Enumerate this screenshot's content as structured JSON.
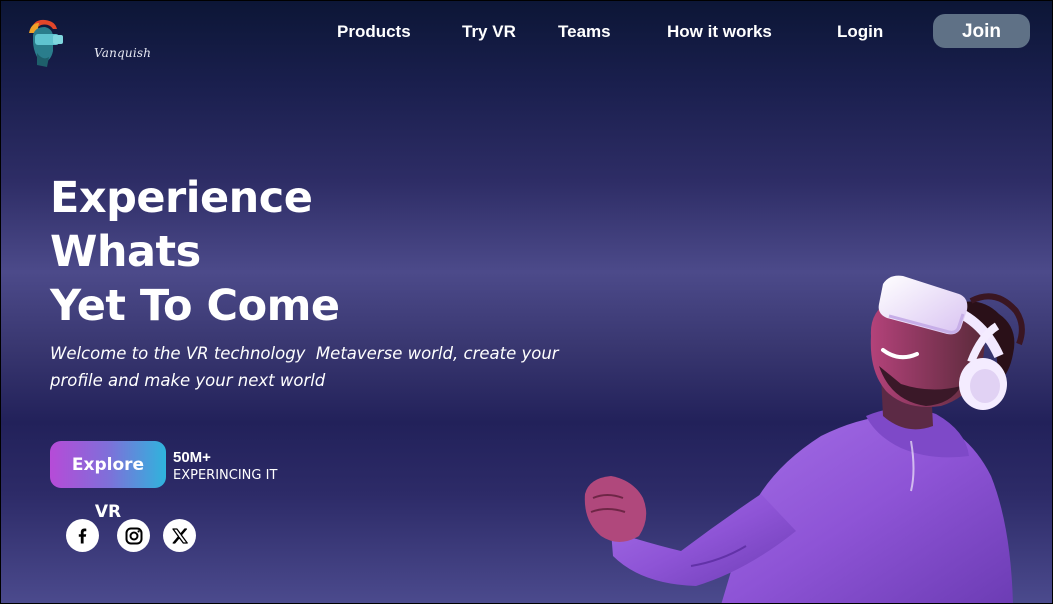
{
  "brand": {
    "name": "Vanquish"
  },
  "nav": {
    "items": [
      {
        "label": "Products"
      },
      {
        "label": "Try VR"
      },
      {
        "label": "Teams"
      },
      {
        "label": "How it works"
      },
      {
        "label": "Login"
      }
    ],
    "join_label": "Join"
  },
  "hero": {
    "title_lines": [
      "Experience",
      "Whats",
      "Yet To Come"
    ],
    "subtitle_lines": [
      "Welcome to the VR technology  Metaverse world, create your",
      "profile and make your next world"
    ],
    "cta_label": "Explore VR",
    "stat_value": "50M+",
    "stat_label": "EXPERINCING IT"
  },
  "social": {
    "icons": [
      "facebook-icon",
      "instagram-icon",
      "x-icon"
    ]
  },
  "colors": {
    "background_top": "#0c1636",
    "background_mid": "#4c4a8a",
    "join_button": "#5f7186",
    "cta_gradient_start": "#b64bd8",
    "cta_gradient_end": "#2fb4dd",
    "hoodie": "#8e54d6"
  }
}
